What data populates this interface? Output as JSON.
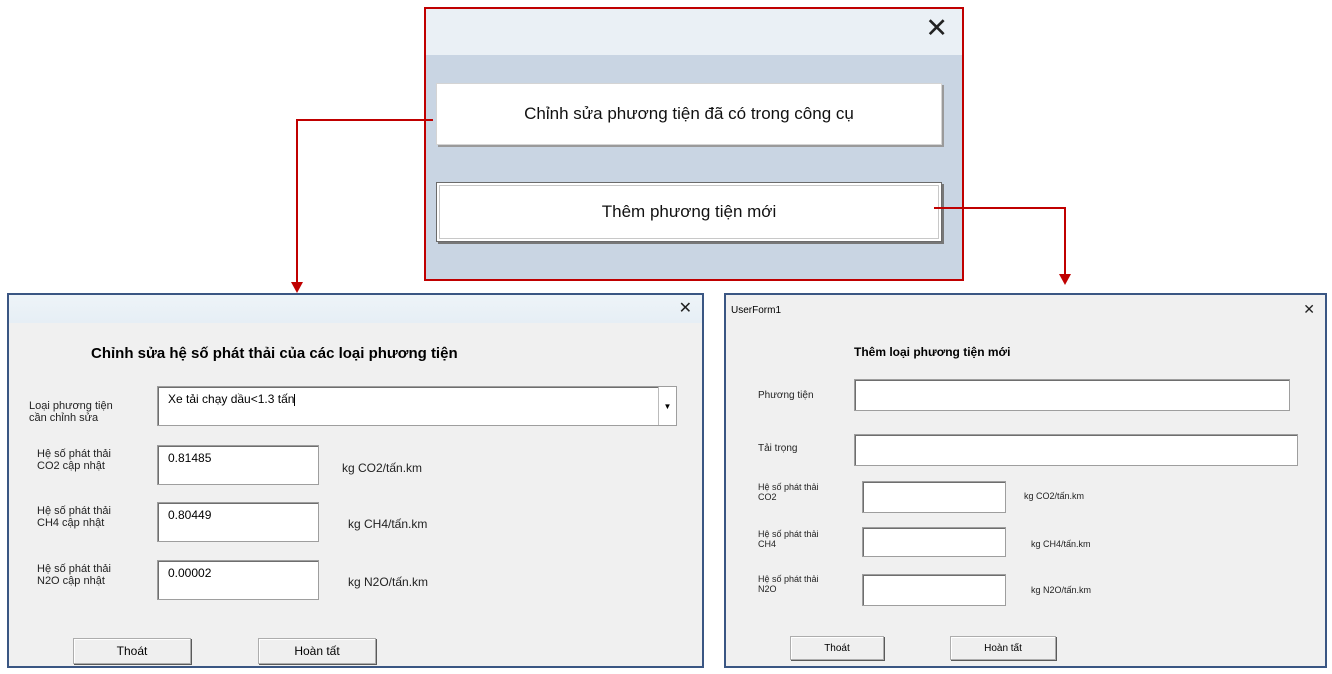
{
  "menu_dialog": {
    "close_icon": "close-icon",
    "edit_button": "Chỉnh sửa phương tiện đã có trong công cụ",
    "add_button": "Thêm phương tiện mới"
  },
  "edit_form": {
    "close_icon": "close-icon",
    "heading": "Chỉnh sửa hệ số phát thải của các loại phương tiện",
    "vehicle_label": "Loại phương tiện\ncần chỉnh sửa",
    "vehicle_value": "Xe tải chạy dầu<1.3 tấn",
    "co2_label": "Hệ số phát thải\nCO2 cập nhật",
    "co2_value": "0.81485",
    "co2_unit": "kg CO2/tấn.km",
    "ch4_label": "Hệ số phát thải\nCH4 cập nhật",
    "ch4_value": "0.80449",
    "ch4_unit": "kg CH4/tấn.km",
    "n2o_label": "Hệ số phát thải\nN2O cập nhật",
    "n2o_value": "0.00002",
    "n2o_unit": "kg N2O/tấn.km",
    "exit_button": "Thoát",
    "done_button": "Hoàn tất"
  },
  "add_form": {
    "title": "UserForm1",
    "close_icon": "close-icon",
    "heading": "Thêm loại phương tiện mới",
    "vehicle_label": "Phương tiện",
    "vehicle_value": "",
    "load_label": "Tải trọng",
    "load_value": "",
    "co2_label": "Hệ số phát thải\nCO2",
    "co2_value": "",
    "co2_unit": "kg CO2/tấn.km",
    "ch4_label": "Hệ số phát thải\nCH4",
    "ch4_value": "",
    "ch4_unit": "kg CH4/tấn.km",
    "n2o_label": "Hệ số phát thải\nN2O",
    "n2o_value": "",
    "n2o_unit": "kg N2O/tấn.km",
    "exit_button": "Thoát",
    "done_button": "Hoàn tất"
  },
  "colors": {
    "arrow": "#c00000",
    "menu_border": "#c00000",
    "dialog_border": "#3a5683",
    "menu_background": "#c9d5e3"
  }
}
